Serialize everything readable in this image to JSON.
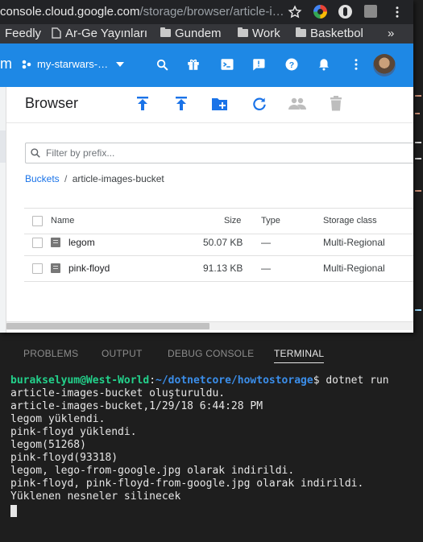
{
  "browser": {
    "url_host": "console.cloud.google.com",
    "url_path": "/storage/browser/article-i…",
    "bookmarks": [
      {
        "label": "Feedly",
        "type": "text"
      },
      {
        "label": "Ar-Ge Yayınları",
        "type": "page"
      },
      {
        "label": "Gundem",
        "type": "folder"
      },
      {
        "label": "Work",
        "type": "folder"
      },
      {
        "label": "Basketbol",
        "type": "folder"
      }
    ],
    "bookmarks_overflow": "»"
  },
  "console": {
    "logo_fragment": "m",
    "project": "my-starwars-…",
    "page_title": "Browser",
    "filter_placeholder": "Filter by prefix...",
    "breadcrumb_root": "Buckets",
    "breadcrumb_sep": "/",
    "breadcrumb_current": "article-images-bucket",
    "columns": {
      "name": "Name",
      "size": "Size",
      "type": "Type",
      "storage_class": "Storage class"
    },
    "rows": [
      {
        "name": "legom",
        "size": "50.07 KB",
        "type": "—",
        "storage_class": "Multi-Regional"
      },
      {
        "name": "pink-floyd",
        "size": "91.13 KB",
        "type": "—",
        "storage_class": "Multi-Regional"
      }
    ]
  },
  "panel": {
    "tabs": [
      "PROBLEMS",
      "OUTPUT",
      "DEBUG CONSOLE",
      "TERMINAL"
    ],
    "active_tab": "TERMINAL"
  },
  "terminal": {
    "prompt_user": "burakselyum@West-World",
    "prompt_sep": ":",
    "prompt_path": "~/dotnetcore/howtostorage",
    "prompt_symbol": "$",
    "command": " dotnet run",
    "output": [
      "article-images-bucket oluşturuldu.",
      "article-images-bucket,1/29/18 6:44:28 PM",
      "legom yüklendi.",
      "pink-floyd yüklendi.",
      "legom(51268)",
      "pink-floyd(93318)",
      "legom, lego-from-google.jpg olarak indirildi.",
      "pink-floyd, pink-floyd-from-google.jpg olarak indirildi.",
      "Yüklenen nesneler silinecek"
    ]
  },
  "colors": {
    "accent": "#1a73e8",
    "terminal_user": "#23d18b",
    "terminal_path": "#3b8eea"
  }
}
